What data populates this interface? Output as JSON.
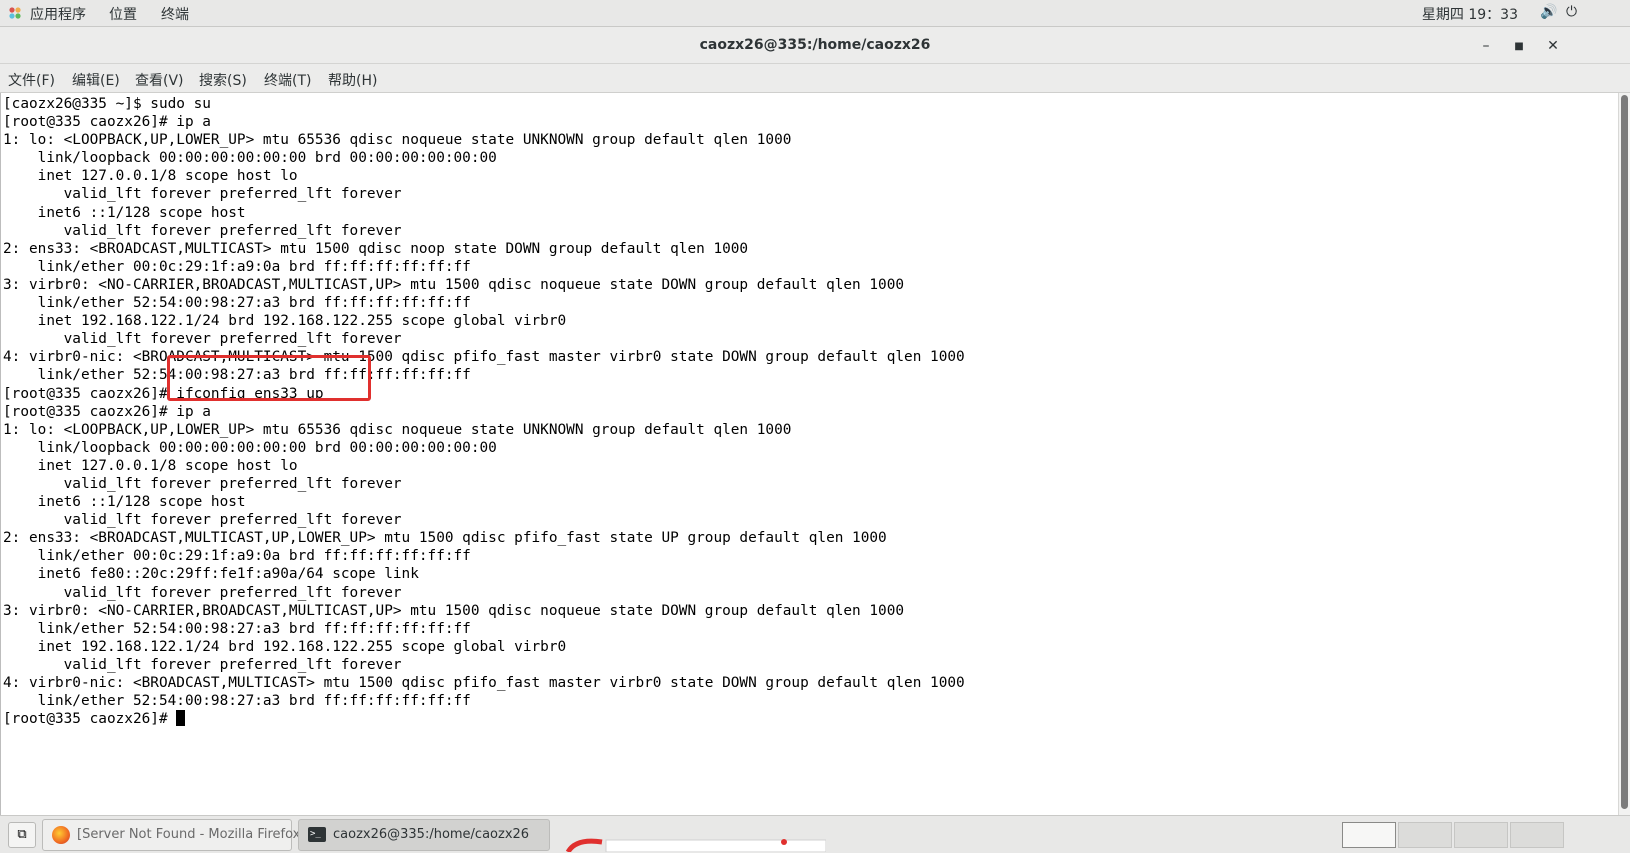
{
  "top_panel": {
    "applications": "应用程序",
    "places": "位置",
    "terminal": "终端",
    "clock": "星期四 19：33"
  },
  "window": {
    "title": "caozx26@335:/home/caozx26"
  },
  "menubar": {
    "file": "文件(F)",
    "edit": "编辑(E)",
    "view": "查看(V)",
    "search": "搜索(S)",
    "terminal": "终端(T)",
    "help": "帮助(H)"
  },
  "terminal": {
    "lines": [
      "[caozx26@335 ~]$ sudo su",
      "[root@335 caozx26]# ip a",
      "1: lo: <LOOPBACK,UP,LOWER_UP> mtu 65536 qdisc noqueue state UNKNOWN group default qlen 1000",
      "    link/loopback 00:00:00:00:00:00 brd 00:00:00:00:00:00",
      "    inet 127.0.0.1/8 scope host lo",
      "       valid_lft forever preferred_lft forever",
      "    inet6 ::1/128 scope host",
      "       valid_lft forever preferred_lft forever",
      "2: ens33: <BROADCAST,MULTICAST> mtu 1500 qdisc noop state DOWN group default qlen 1000",
      "    link/ether 00:0c:29:1f:a9:0a brd ff:ff:ff:ff:ff:ff",
      "3: virbr0: <NO-CARRIER,BROADCAST,MULTICAST,UP> mtu 1500 qdisc noqueue state DOWN group default qlen 1000",
      "    link/ether 52:54:00:98:27:a3 brd ff:ff:ff:ff:ff:ff",
      "    inet 192.168.122.1/24 brd 192.168.122.255 scope global virbr0",
      "       valid_lft forever preferred_lft forever",
      "4: virbr0-nic: <BROADCAST,MULTICAST> mtu 1500 qdisc pfifo_fast master virbr0 state DOWN group default qlen 1000",
      "    link/ether 52:54:00:98:27:a3 brd ff:ff:ff:ff:ff:ff",
      "[root@335 caozx26]# ifconfig ens33 up",
      "[root@335 caozx26]# ip a",
      "1: lo: <LOOPBACK,UP,LOWER_UP> mtu 65536 qdisc noqueue state UNKNOWN group default qlen 1000",
      "    link/loopback 00:00:00:00:00:00 brd 00:00:00:00:00:00",
      "    inet 127.0.0.1/8 scope host lo",
      "       valid_lft forever preferred_lft forever",
      "    inet6 ::1/128 scope host",
      "       valid_lft forever preferred_lft forever",
      "2: ens33: <BROADCAST,MULTICAST,UP,LOWER_UP> mtu 1500 qdisc pfifo_fast state UP group default qlen 1000",
      "    link/ether 00:0c:29:1f:a9:0a brd ff:ff:ff:ff:ff:ff",
      "    inet6 fe80::20c:29ff:fe1f:a90a/64 scope link",
      "       valid_lft forever preferred_lft forever",
      "3: virbr0: <NO-CARRIER,BROADCAST,MULTICAST,UP> mtu 1500 qdisc noqueue state DOWN group default qlen 1000",
      "    link/ether 52:54:00:98:27:a3 brd ff:ff:ff:ff:ff:ff",
      "    inet 192.168.122.1/24 brd 192.168.122.255 scope global virbr0",
      "       valid_lft forever preferred_lft forever",
      "4: virbr0-nic: <BROADCAST,MULTICAST> mtu 1500 qdisc pfifo_fast master virbr0 state DOWN group default qlen 1000",
      "    link/ether 52:54:00:98:27:a3 brd ff:ff:ff:ff:ff:ff"
    ],
    "prompt": "[root@335 caozx26]# "
  },
  "taskbar": {
    "tasks": [
      {
        "label": "[Server Not Found - Mozilla Firefox]",
        "icon": "firefox-icon"
      },
      {
        "label": "caozx26@335:/home/caozx26",
        "icon": "terminal-icon"
      }
    ]
  },
  "colors": {
    "highlight": "#e0302e",
    "panel": "#e8e8e7"
  }
}
